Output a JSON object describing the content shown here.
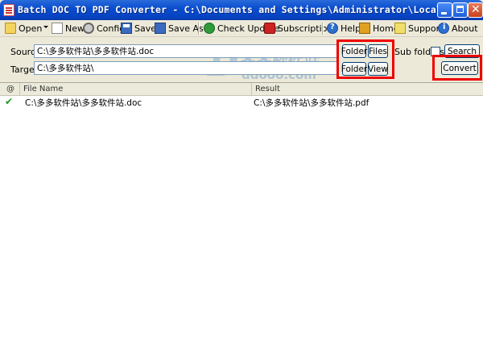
{
  "window": {
    "title": "Batch DOC TO PDF Converter - C:\\Documents and Settings\\Administrator\\Local Setting..."
  },
  "toolbar": {
    "open": "Open",
    "new": "New",
    "config": "Config",
    "save": "Save",
    "save_as": "Save As",
    "check_update": "Check Update",
    "subscriptions": "Subscriptions",
    "help": "Help",
    "home": "Home",
    "support": "Support",
    "about": "About"
  },
  "source": {
    "label": "Source",
    "value": "C:\\多多软件站\\多多软件站.doc",
    "folder_button": "Folder",
    "files_button": "Files"
  },
  "target": {
    "label": "Target",
    "value": "C:\\多多软件站\\",
    "folder_button": "Folder",
    "view_button": "View"
  },
  "options": {
    "sub_folders_label": "Sub folders",
    "search_button": "Search",
    "convert_button": "Convert"
  },
  "watermark": {
    "text": "多多软件站",
    "domain": "ddooo.com"
  },
  "list": {
    "columns": [
      "@",
      "File Name",
      "Result"
    ],
    "rows": [
      {
        "status": "success",
        "file": "C:\\多多软件站\\多多软件站.doc",
        "result": "C:\\多多软件站\\多多软件站.pdf"
      }
    ]
  },
  "colors": {
    "title_bar": "#0a4ed0",
    "highlight": "#ee0000",
    "success": "#1a9a1a"
  }
}
